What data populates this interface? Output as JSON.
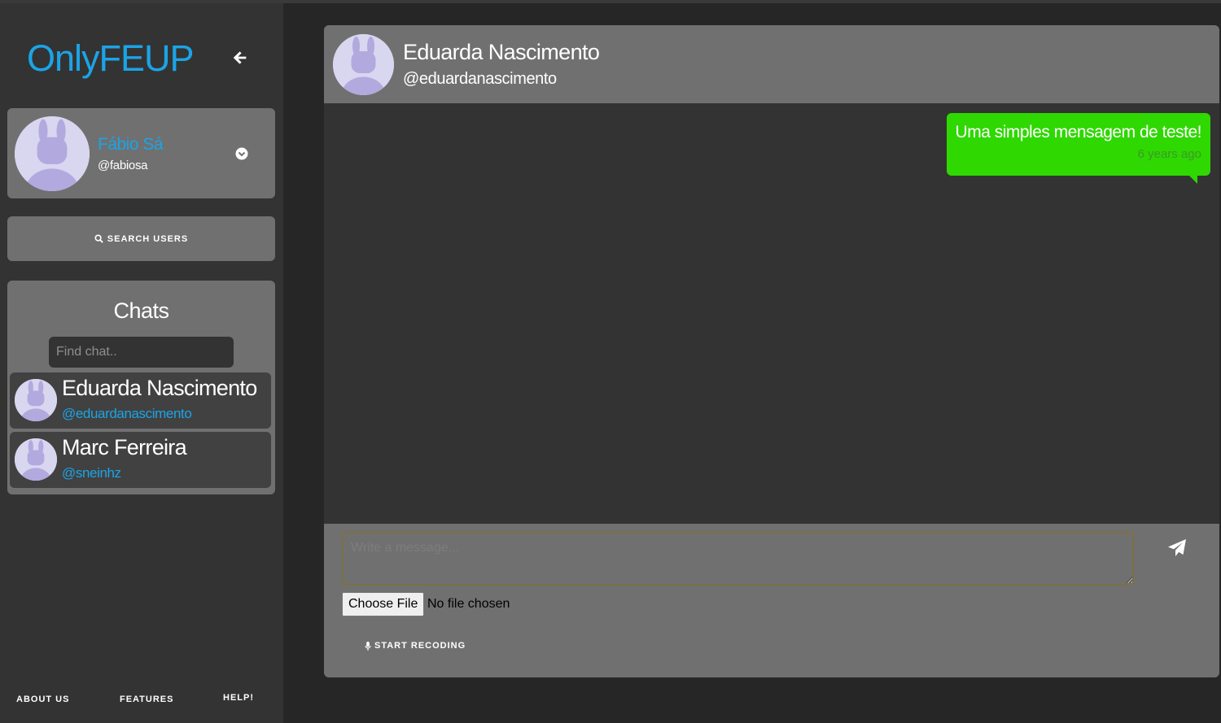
{
  "sidebar": {
    "brand": "OnlyFEUP",
    "profile": {
      "name": "Fábio Sá",
      "handle": "@fabiosa"
    },
    "search_users_label": "SEARCH USERS",
    "chats": {
      "title": "Chats",
      "find_placeholder": "Find chat..",
      "items": [
        {
          "name": "Eduarda Nascimento",
          "handle": "@eduardanascimento"
        },
        {
          "name": "Marc Ferreira",
          "handle": "@sneinhz"
        }
      ]
    },
    "footer": {
      "about": "ABOUT US",
      "features": "FEATURES",
      "help": "HELP!"
    }
  },
  "chat": {
    "header": {
      "name": "Eduarda Nascimento",
      "handle": "@eduardanascimento"
    },
    "messages": [
      {
        "text": "Uma simples mensagem de teste!",
        "time": "6 years ago",
        "direction": "outgoing"
      }
    ],
    "composer": {
      "placeholder": "Write a message...",
      "file_button": "Choose File",
      "file_status": "No file chosen",
      "record_label": "START RECODING"
    }
  },
  "colors": {
    "brand": "#1ba4e6",
    "panel": "#707070",
    "sidebar": "#333333",
    "background": "#262626",
    "outgoing_bubble": "#2ed800"
  },
  "icons": [
    "arrow-left-icon",
    "chevron-down-circle-icon",
    "search-icon",
    "send-icon",
    "microphone-icon",
    "avatar-bunny-icon"
  ]
}
